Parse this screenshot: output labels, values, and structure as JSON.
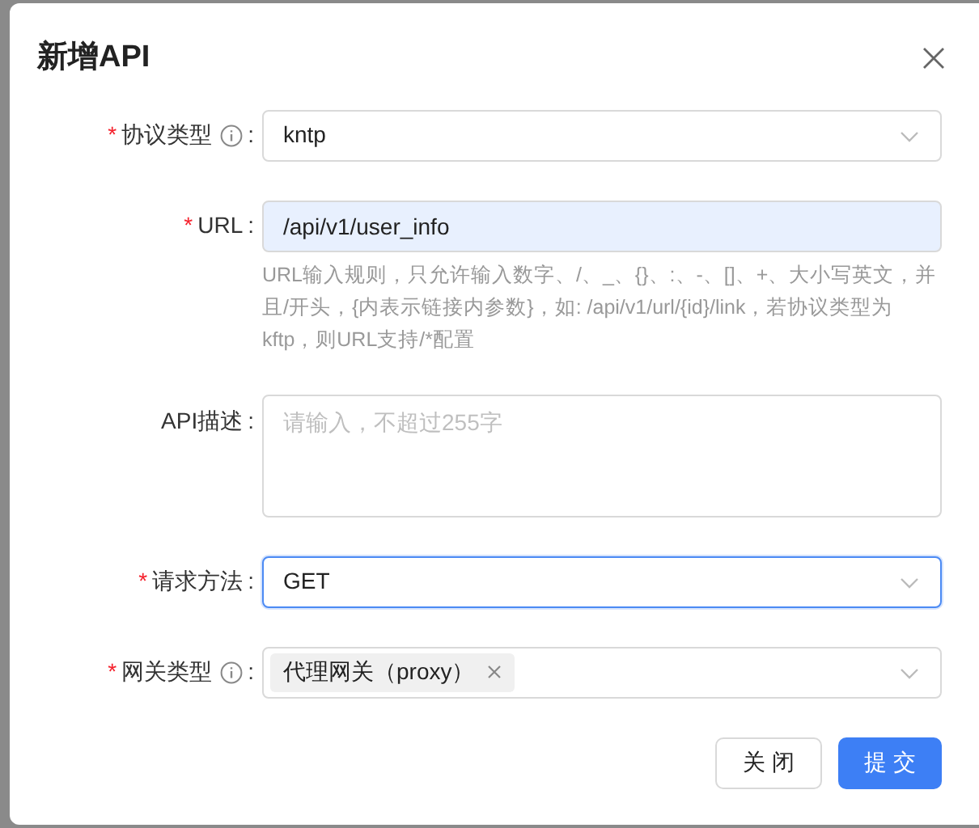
{
  "dialog": {
    "title": "新增API"
  },
  "fields": [
    {
      "kind": "select",
      "required_mark": "*",
      "label": "协议类型",
      "info": true,
      "colon": ":",
      "focused": false,
      "autofilled": false,
      "value": "kntp"
    },
    {
      "kind": "input",
      "required_mark": "*",
      "label": "URL",
      "info": false,
      "colon": ":",
      "focused": false,
      "autofilled": true,
      "value": "/api/v1/user_info",
      "help": "URL输入规则，只允许输入数字、/、_、{}、:、-、[]、+、大小写英文，并且/开头，{内表示链接内参数}，如: /api/v1/url/{id}/link，若协议类型为kftp，则URL支持/*配置"
    },
    {
      "kind": "textarea",
      "label": "API描述",
      "info": false,
      "colon": ":",
      "focused": false,
      "autofilled": false,
      "placeholder": "请输入，不超过255字"
    },
    {
      "kind": "select",
      "required_mark": "*",
      "label": "请求方法",
      "info": false,
      "colon": ":",
      "focused": true,
      "autofilled": false,
      "value": "GET"
    },
    {
      "kind": "tags",
      "required_mark": "*",
      "label": "网关类型",
      "info": true,
      "colon": ":",
      "focused": false,
      "autofilled": false,
      "tags": [
        "代理网关（proxy）"
      ]
    }
  ],
  "buttons": [
    {
      "label": "关 闭",
      "primary": false
    },
    {
      "label": "提 交",
      "primary": true
    }
  ]
}
